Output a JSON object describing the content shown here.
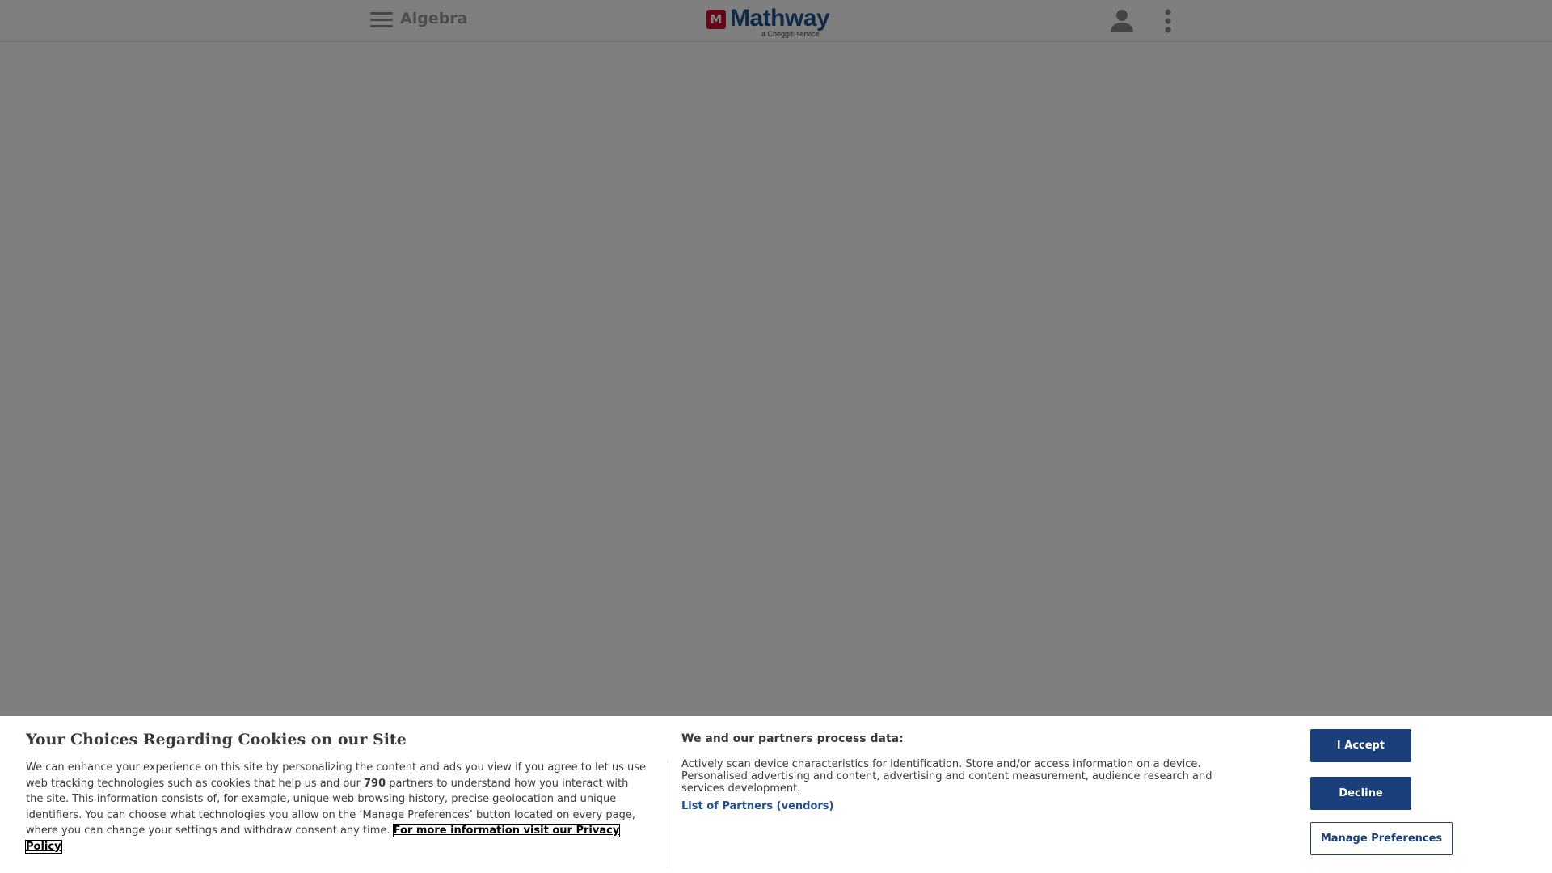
{
  "header": {
    "subject": "Algebra",
    "logo_word": "Mathway",
    "logo_tagline": "a Chegg® service",
    "logo_mark": "M"
  },
  "icons": {
    "menu": "hamburger-menu-icon",
    "user": "user-icon",
    "more": "more-vertical-icon"
  },
  "cookie_banner": {
    "title": "Your Choices Regarding Cookies on our Site",
    "text_before_count": "We can enhance your experience on this site by personalizing the content and ads you view if you agree to let us use web tracking technologies such as cookies that help us and our ",
    "partner_count": "790",
    "text_after_count": " partners to understand how you interact with the site. This information consists of, for example, unique web browsing history, precise geolocation and unique identifiers. You can choose what technologies you allow on the ‘Manage Preferences’ button located on every page, where you can change your settings and withdraw consent any time. ",
    "privacy_link": "For more information visit our Privacy Policy",
    "process_title": "We and our partners process data:",
    "process_text": "Actively scan device characteristics for identification. Store and/or access information on a device. Personalised advertising and content, advertising and content measurement, audience research and services development.",
    "vendors_link": "List of Partners (vendors)",
    "accept_label": "I Accept",
    "decline_label": "Decline",
    "manage_label": "Manage Preferences"
  },
  "colors": {
    "brand_blue": "#23508f",
    "button_blue": "#1b3f7b",
    "logo_red": "#c8102e",
    "overlay": "rgba(0,0,0,0.5)"
  }
}
